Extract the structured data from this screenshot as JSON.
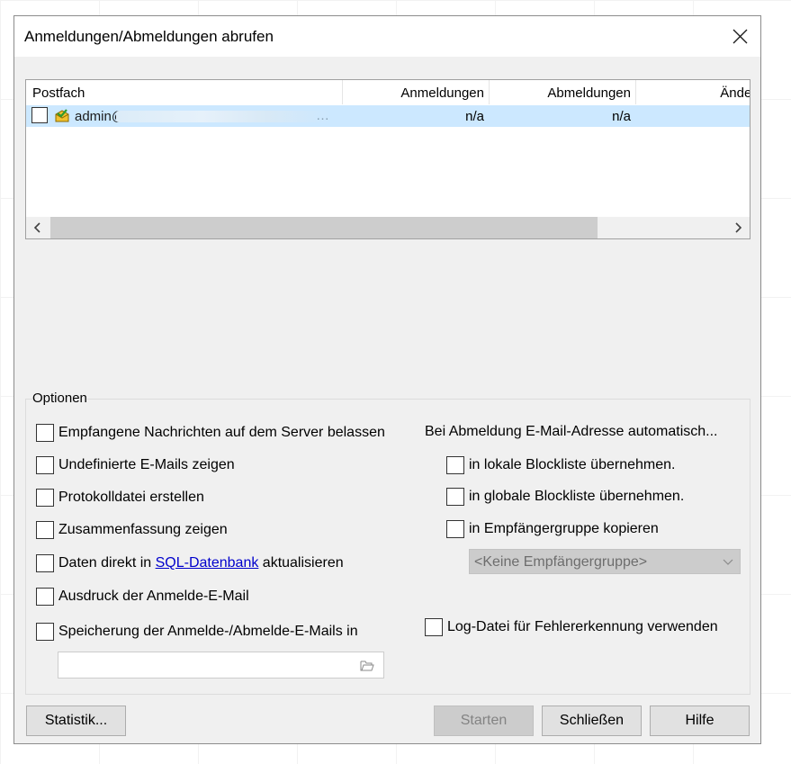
{
  "window": {
    "title": "Anmeldungen/Abmeldungen abrufen"
  },
  "mailbox_list": {
    "columns": [
      "Postfach",
      "Anmeldungen",
      "Abmeldungen",
      "Änderun"
    ],
    "rows": [
      {
        "checked": false,
        "mailbox": "admin@",
        "mailbox_truncated": "…",
        "anmeldungen": "n/a",
        "abmeldungen": "n/a"
      }
    ]
  },
  "options": {
    "group_label": "Optionen",
    "left": [
      {
        "label": "Empfangene Nachrichten auf dem Server belassen",
        "checked": false
      },
      {
        "label": "Undefinierte E-Mails zeigen",
        "checked": false
      },
      {
        "label": "Protokolldatei erstellen",
        "checked": false
      },
      {
        "label": "Zusammenfassung zeigen",
        "checked": false
      },
      {
        "label_before": "Daten direkt in ",
        "link": "SQL-Datenbank",
        "label_after": " aktualisieren",
        "checked": false
      },
      {
        "label": "Ausdruck der Anmelde-E-Mail",
        "checked": false
      },
      {
        "label": "Speicherung der Anmelde-/Abmelde-E-Mails in",
        "checked": false
      }
    ],
    "save_path_value": "",
    "auto_heading": "Bei Abmeldung E-Mail-Adresse automatisch...",
    "right": [
      {
        "label": "in lokale Blockliste übernehmen.",
        "checked": false
      },
      {
        "label": "in globale Blockliste übernehmen.",
        "checked": false
      },
      {
        "label": "in Empfängergruppe kopieren",
        "checked": false
      }
    ],
    "recipient_group_select": {
      "selected": "<Keine Empfängergruppe>",
      "enabled": false
    },
    "log_file": {
      "label": "Log-Datei für Fehlererkennung verwenden",
      "checked": false
    }
  },
  "buttons": {
    "statistics": "Statistik...",
    "start": "Starten",
    "start_enabled": false,
    "close": "Schließen",
    "help": "Hilfe"
  },
  "colors": {
    "dialog_bg": "#f0f0f0",
    "selection": "#cce8ff",
    "link": "#0000cc",
    "disabled_bg": "#cccccc"
  },
  "icons": [
    "close-icon",
    "mailbox-icon",
    "scroll-left-icon",
    "scroll-right-icon",
    "chevron-down-icon",
    "folder-open-icon"
  ]
}
